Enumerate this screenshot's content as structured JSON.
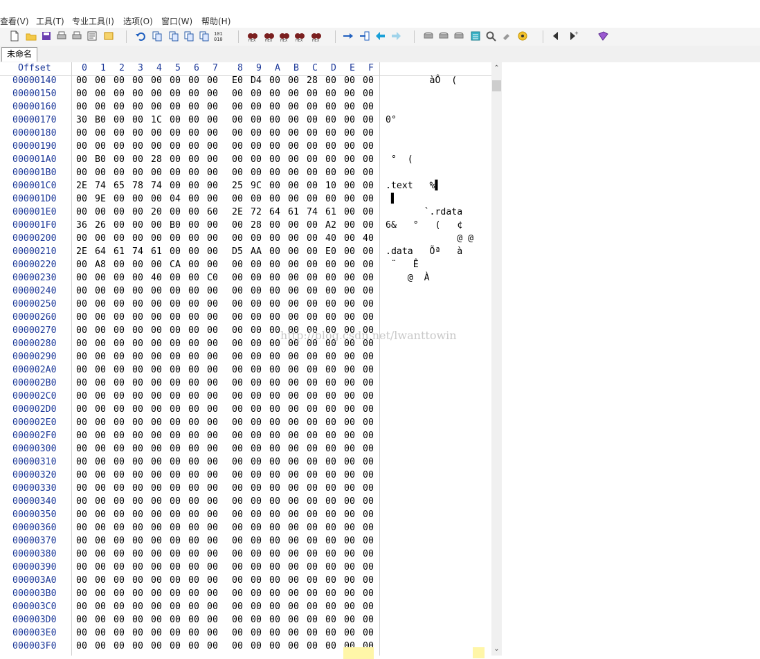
{
  "menu": [
    "查看(V)",
    "工具(T)",
    "专业工具(I)",
    "选项(O)",
    "窗口(W)",
    "帮助(H)"
  ],
  "toolbar_icons": [
    "new-file-icon",
    "open-folder-icon",
    "save-icon",
    "print-icon",
    "print-preview-icon",
    "properties-icon",
    "open-readonly-icon",
    "undo-icon",
    "copy-icon",
    "copy-block-icon",
    "paste-icon",
    "paste-block-icon",
    "binary-icon",
    "find-icon",
    "find-replace-icon",
    "find-hex-icon",
    "replace-hex-icon",
    "find-next-hex-icon",
    "goto-offset-icon",
    "goto-sector-icon",
    "back-icon",
    "forward-icon",
    "open-disk-icon",
    "open-ram-icon",
    "disk-icon",
    "calculator-icon",
    "search-icon",
    "tools-icon",
    "settings-icon",
    "prev-tab-icon",
    "next-tab-icon",
    "help-book-icon"
  ],
  "tab": {
    "label": "未命名"
  },
  "header": {
    "offset_label": "Offset",
    "columns": [
      "0",
      "1",
      "2",
      "3",
      "4",
      "5",
      "6",
      "7",
      "8",
      "9",
      "A",
      "B",
      "C",
      "D",
      "E",
      "F"
    ]
  },
  "rows": [
    {
      "offset": "00000140",
      "hex": [
        "00",
        "00",
        "00",
        "00",
        "00",
        "00",
        "00",
        "00",
        "E0",
        "D4",
        "00",
        "00",
        "28",
        "00",
        "00",
        "00"
      ],
      "ascii": "        àÔ  (   "
    },
    {
      "offset": "00000150",
      "hex": [
        "00",
        "00",
        "00",
        "00",
        "00",
        "00",
        "00",
        "00",
        "00",
        "00",
        "00",
        "00",
        "00",
        "00",
        "00",
        "00"
      ],
      "ascii": ""
    },
    {
      "offset": "00000160",
      "hex": [
        "00",
        "00",
        "00",
        "00",
        "00",
        "00",
        "00",
        "00",
        "00",
        "00",
        "00",
        "00",
        "00",
        "00",
        "00",
        "00"
      ],
      "ascii": ""
    },
    {
      "offset": "00000170",
      "hex": [
        "30",
        "B0",
        "00",
        "00",
        "1C",
        "00",
        "00",
        "00",
        "00",
        "00",
        "00",
        "00",
        "00",
        "00",
        "00",
        "00"
      ],
      "ascii": "0°"
    },
    {
      "offset": "00000180",
      "hex": [
        "00",
        "00",
        "00",
        "00",
        "00",
        "00",
        "00",
        "00",
        "00",
        "00",
        "00",
        "00",
        "00",
        "00",
        "00",
        "00"
      ],
      "ascii": ""
    },
    {
      "offset": "00000190",
      "hex": [
        "00",
        "00",
        "00",
        "00",
        "00",
        "00",
        "00",
        "00",
        "00",
        "00",
        "00",
        "00",
        "00",
        "00",
        "00",
        "00"
      ],
      "ascii": ""
    },
    {
      "offset": "000001A0",
      "hex": [
        "00",
        "B0",
        "00",
        "00",
        "28",
        "00",
        "00",
        "00",
        "00",
        "00",
        "00",
        "00",
        "00",
        "00",
        "00",
        "00"
      ],
      "ascii": " °  ("
    },
    {
      "offset": "000001B0",
      "hex": [
        "00",
        "00",
        "00",
        "00",
        "00",
        "00",
        "00",
        "00",
        "00",
        "00",
        "00",
        "00",
        "00",
        "00",
        "00",
        "00"
      ],
      "ascii": ""
    },
    {
      "offset": "000001C0",
      "hex": [
        "2E",
        "74",
        "65",
        "78",
        "74",
        "00",
        "00",
        "00",
        "25",
        "9C",
        "00",
        "00",
        "00",
        "10",
        "00",
        "00"
      ],
      "ascii": ".text   %▌"
    },
    {
      "offset": "000001D0",
      "hex": [
        "00",
        "9E",
        "00",
        "00",
        "00",
        "04",
        "00",
        "00",
        "00",
        "00",
        "00",
        "00",
        "00",
        "00",
        "00",
        "00"
      ],
      "ascii": " ▌"
    },
    {
      "offset": "000001E0",
      "hex": [
        "00",
        "00",
        "00",
        "00",
        "20",
        "00",
        "00",
        "60",
        "2E",
        "72",
        "64",
        "61",
        "74",
        "61",
        "00",
        "00"
      ],
      "ascii": "       `.rdata"
    },
    {
      "offset": "000001F0",
      "hex": [
        "36",
        "26",
        "00",
        "00",
        "00",
        "B0",
        "00",
        "00",
        "00",
        "28",
        "00",
        "00",
        "00",
        "A2",
        "00",
        "00"
      ],
      "ascii": "6&   °   (   ¢"
    },
    {
      "offset": "00000200",
      "hex": [
        "00",
        "00",
        "00",
        "00",
        "00",
        "00",
        "00",
        "00",
        "00",
        "00",
        "00",
        "00",
        "00",
        "40",
        "00",
        "40"
      ],
      "ascii": "             @ @"
    },
    {
      "offset": "00000210",
      "hex": [
        "2E",
        "64",
        "61",
        "74",
        "61",
        "00",
        "00",
        "00",
        "D5",
        "AA",
        "00",
        "00",
        "00",
        "E0",
        "00",
        "00"
      ],
      "ascii": ".data   Õª   à"
    },
    {
      "offset": "00000220",
      "hex": [
        "00",
        "A8",
        "00",
        "00",
        "00",
        "CA",
        "00",
        "00",
        "00",
        "00",
        "00",
        "00",
        "00",
        "00",
        "00",
        "00"
      ],
      "ascii": " ¨   Ê"
    },
    {
      "offset": "00000230",
      "hex": [
        "00",
        "00",
        "00",
        "00",
        "40",
        "00",
        "00",
        "C0",
        "00",
        "00",
        "00",
        "00",
        "00",
        "00",
        "00",
        "00"
      ],
      "ascii": "    @  À"
    },
    {
      "offset": "00000240",
      "hex": [
        "00",
        "00",
        "00",
        "00",
        "00",
        "00",
        "00",
        "00",
        "00",
        "00",
        "00",
        "00",
        "00",
        "00",
        "00",
        "00"
      ],
      "ascii": ""
    },
    {
      "offset": "00000250",
      "hex": [
        "00",
        "00",
        "00",
        "00",
        "00",
        "00",
        "00",
        "00",
        "00",
        "00",
        "00",
        "00",
        "00",
        "00",
        "00",
        "00"
      ],
      "ascii": ""
    },
    {
      "offset": "00000260",
      "hex": [
        "00",
        "00",
        "00",
        "00",
        "00",
        "00",
        "00",
        "00",
        "00",
        "00",
        "00",
        "00",
        "00",
        "00",
        "00",
        "00"
      ],
      "ascii": ""
    },
    {
      "offset": "00000270",
      "hex": [
        "00",
        "00",
        "00",
        "00",
        "00",
        "00",
        "00",
        "00",
        "00",
        "00",
        "00",
        "00",
        "00",
        "00",
        "00",
        "00"
      ],
      "ascii": ""
    },
    {
      "offset": "00000280",
      "hex": [
        "00",
        "00",
        "00",
        "00",
        "00",
        "00",
        "00",
        "00",
        "00",
        "00",
        "00",
        "00",
        "00",
        "00",
        "00",
        "00"
      ],
      "ascii": ""
    },
    {
      "offset": "00000290",
      "hex": [
        "00",
        "00",
        "00",
        "00",
        "00",
        "00",
        "00",
        "00",
        "00",
        "00",
        "00",
        "00",
        "00",
        "00",
        "00",
        "00"
      ],
      "ascii": ""
    },
    {
      "offset": "000002A0",
      "hex": [
        "00",
        "00",
        "00",
        "00",
        "00",
        "00",
        "00",
        "00",
        "00",
        "00",
        "00",
        "00",
        "00",
        "00",
        "00",
        "00"
      ],
      "ascii": ""
    },
    {
      "offset": "000002B0",
      "hex": [
        "00",
        "00",
        "00",
        "00",
        "00",
        "00",
        "00",
        "00",
        "00",
        "00",
        "00",
        "00",
        "00",
        "00",
        "00",
        "00"
      ],
      "ascii": ""
    },
    {
      "offset": "000002C0",
      "hex": [
        "00",
        "00",
        "00",
        "00",
        "00",
        "00",
        "00",
        "00",
        "00",
        "00",
        "00",
        "00",
        "00",
        "00",
        "00",
        "00"
      ],
      "ascii": ""
    },
    {
      "offset": "000002D0",
      "hex": [
        "00",
        "00",
        "00",
        "00",
        "00",
        "00",
        "00",
        "00",
        "00",
        "00",
        "00",
        "00",
        "00",
        "00",
        "00",
        "00"
      ],
      "ascii": ""
    },
    {
      "offset": "000002E0",
      "hex": [
        "00",
        "00",
        "00",
        "00",
        "00",
        "00",
        "00",
        "00",
        "00",
        "00",
        "00",
        "00",
        "00",
        "00",
        "00",
        "00"
      ],
      "ascii": ""
    },
    {
      "offset": "000002F0",
      "hex": [
        "00",
        "00",
        "00",
        "00",
        "00",
        "00",
        "00",
        "00",
        "00",
        "00",
        "00",
        "00",
        "00",
        "00",
        "00",
        "00"
      ],
      "ascii": ""
    },
    {
      "offset": "00000300",
      "hex": [
        "00",
        "00",
        "00",
        "00",
        "00",
        "00",
        "00",
        "00",
        "00",
        "00",
        "00",
        "00",
        "00",
        "00",
        "00",
        "00"
      ],
      "ascii": ""
    },
    {
      "offset": "00000310",
      "hex": [
        "00",
        "00",
        "00",
        "00",
        "00",
        "00",
        "00",
        "00",
        "00",
        "00",
        "00",
        "00",
        "00",
        "00",
        "00",
        "00"
      ],
      "ascii": ""
    },
    {
      "offset": "00000320",
      "hex": [
        "00",
        "00",
        "00",
        "00",
        "00",
        "00",
        "00",
        "00",
        "00",
        "00",
        "00",
        "00",
        "00",
        "00",
        "00",
        "00"
      ],
      "ascii": ""
    },
    {
      "offset": "00000330",
      "hex": [
        "00",
        "00",
        "00",
        "00",
        "00",
        "00",
        "00",
        "00",
        "00",
        "00",
        "00",
        "00",
        "00",
        "00",
        "00",
        "00"
      ],
      "ascii": ""
    },
    {
      "offset": "00000340",
      "hex": [
        "00",
        "00",
        "00",
        "00",
        "00",
        "00",
        "00",
        "00",
        "00",
        "00",
        "00",
        "00",
        "00",
        "00",
        "00",
        "00"
      ],
      "ascii": ""
    },
    {
      "offset": "00000350",
      "hex": [
        "00",
        "00",
        "00",
        "00",
        "00",
        "00",
        "00",
        "00",
        "00",
        "00",
        "00",
        "00",
        "00",
        "00",
        "00",
        "00"
      ],
      "ascii": ""
    },
    {
      "offset": "00000360",
      "hex": [
        "00",
        "00",
        "00",
        "00",
        "00",
        "00",
        "00",
        "00",
        "00",
        "00",
        "00",
        "00",
        "00",
        "00",
        "00",
        "00"
      ],
      "ascii": ""
    },
    {
      "offset": "00000370",
      "hex": [
        "00",
        "00",
        "00",
        "00",
        "00",
        "00",
        "00",
        "00",
        "00",
        "00",
        "00",
        "00",
        "00",
        "00",
        "00",
        "00"
      ],
      "ascii": ""
    },
    {
      "offset": "00000380",
      "hex": [
        "00",
        "00",
        "00",
        "00",
        "00",
        "00",
        "00",
        "00",
        "00",
        "00",
        "00",
        "00",
        "00",
        "00",
        "00",
        "00"
      ],
      "ascii": ""
    },
    {
      "offset": "00000390",
      "hex": [
        "00",
        "00",
        "00",
        "00",
        "00",
        "00",
        "00",
        "00",
        "00",
        "00",
        "00",
        "00",
        "00",
        "00",
        "00",
        "00"
      ],
      "ascii": ""
    },
    {
      "offset": "000003A0",
      "hex": [
        "00",
        "00",
        "00",
        "00",
        "00",
        "00",
        "00",
        "00",
        "00",
        "00",
        "00",
        "00",
        "00",
        "00",
        "00",
        "00"
      ],
      "ascii": ""
    },
    {
      "offset": "000003B0",
      "hex": [
        "00",
        "00",
        "00",
        "00",
        "00",
        "00",
        "00",
        "00",
        "00",
        "00",
        "00",
        "00",
        "00",
        "00",
        "00",
        "00"
      ],
      "ascii": ""
    },
    {
      "offset": "000003C0",
      "hex": [
        "00",
        "00",
        "00",
        "00",
        "00",
        "00",
        "00",
        "00",
        "00",
        "00",
        "00",
        "00",
        "00",
        "00",
        "00",
        "00"
      ],
      "ascii": ""
    },
    {
      "offset": "000003D0",
      "hex": [
        "00",
        "00",
        "00",
        "00",
        "00",
        "00",
        "00",
        "00",
        "00",
        "00",
        "00",
        "00",
        "00",
        "00",
        "00",
        "00"
      ],
      "ascii": ""
    },
    {
      "offset": "000003E0",
      "hex": [
        "00",
        "00",
        "00",
        "00",
        "00",
        "00",
        "00",
        "00",
        "00",
        "00",
        "00",
        "00",
        "00",
        "00",
        "00",
        "00"
      ],
      "ascii": ""
    },
    {
      "offset": "000003F0",
      "hex": [
        "00",
        "00",
        "00",
        "00",
        "00",
        "00",
        "00",
        "00",
        "00",
        "00",
        "00",
        "00",
        "00",
        "00",
        "00",
        "00"
      ],
      "ascii": ""
    }
  ],
  "watermark": "http://blog.csdn.net/lwanttowin",
  "colors": {
    "offset_text": "#1e3a9a",
    "selection": "#fff6a8"
  }
}
